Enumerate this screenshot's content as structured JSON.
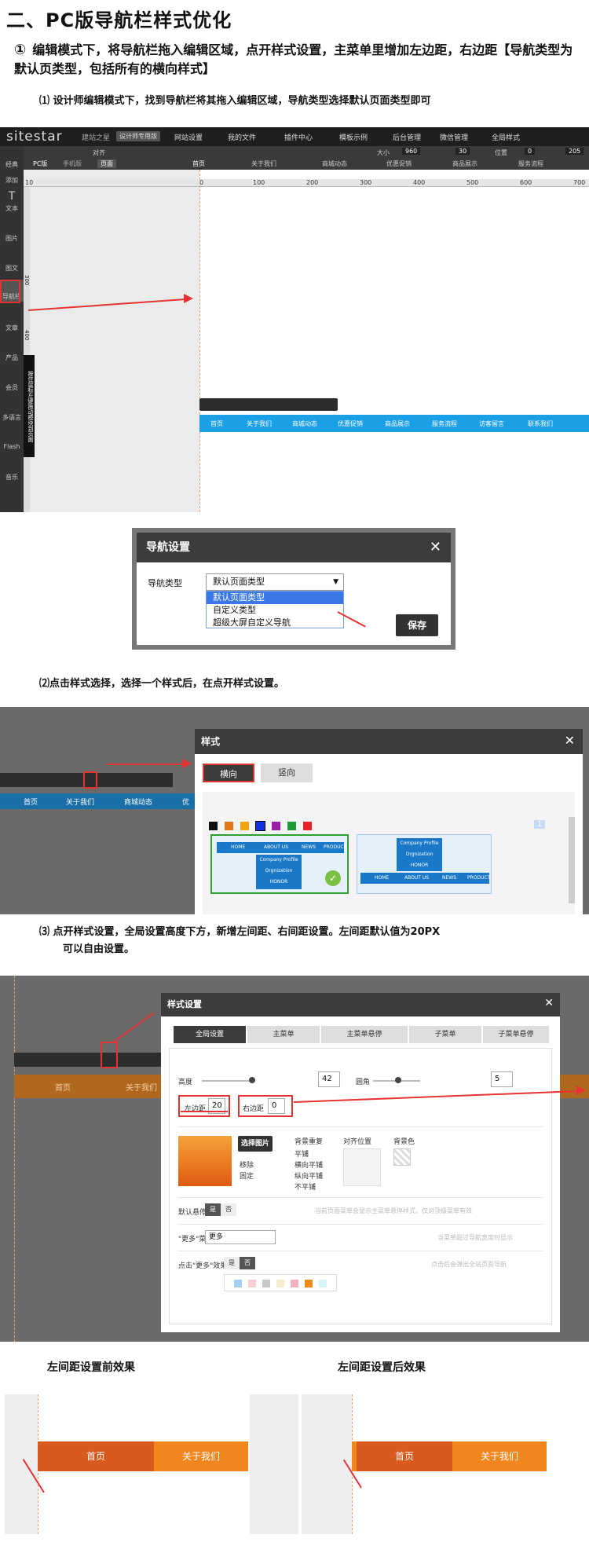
{
  "heading": "二、PC版导航栏样式优化",
  "step1": {
    "num": "①",
    "text": "编辑模式下，将导航栏拖入编辑区域，点开样式设置，主菜单里增加左边距，右边距【导航类型为默认页类型，包括所有的横向样式】"
  },
  "sub1": "⑴  设计师编辑模式下，找到导航栏将其拖入编辑区域，导航类型选择默认页面类型即可",
  "sub2": "⑵点击样式选择，选择一个样式后，在点开样式设置。",
  "sub3_line1": "⑶  点开样式设置，全局设置高度下方，新增左间距、右间距设置。左间距默认值为20PX",
  "sub3_line2": "可以自由设置。",
  "editor": {
    "logo": "sitestar",
    "logo_sub": "建站之星",
    "badge": "设计师专用版",
    "top_menu": [
      "网站设置",
      "我的文件",
      "插件中心",
      "模板示例",
      "后台管理",
      "微信管理",
      "全局样式"
    ],
    "toolbar": {
      "pc": "PC版",
      "mobile": "手机版",
      "align": "对齐",
      "size": "大小",
      "w": "960",
      "px": "px",
      "h": "30",
      "pos": "位置",
      "x": "0",
      "y": "205",
      "page_tab": "页面",
      "page_name": "首页"
    },
    "ruler_ticks": [
      "0",
      "100",
      "200",
      "300",
      "400",
      "500",
      "600",
      "700"
    ],
    "ruler_left": "10",
    "sidebar": [
      "经典",
      "添加",
      "文本",
      "图片",
      "图文",
      "导航栏",
      "文章",
      "产品",
      "会员",
      "多语言",
      "Flash",
      "音乐"
    ],
    "vruler_labels": [
      "300",
      "400",
      "500",
      "600"
    ],
    "page_tabs": [
      "关于我们",
      "商城动态",
      "优惠促销",
      "商品展示",
      "服务流程"
    ],
    "drag_tip": "按住鼠标左键拖动模块到页面",
    "nav_items": [
      "首页",
      "关于我们",
      "商城动态",
      "优惠促销",
      "商品展示",
      "服务流程",
      "访客留言",
      "联系我们"
    ]
  },
  "nav_dialog": {
    "title": "导航设置",
    "label": "导航类型",
    "selected": "默认页面类型",
    "options": [
      "默认页面类型",
      "自定义类型",
      "超级大屏自定义导航"
    ],
    "save": "保存"
  },
  "style_dialog": {
    "title": "样式",
    "tab_h": "横向",
    "tab_v": "竖向",
    "page_num": "1",
    "colors": [
      "#111111",
      "#e0761a",
      "#f2a40c",
      "#1530e0",
      "#9a1fa8",
      "#1c9d38",
      "#e8202a"
    ],
    "preview_nav": [
      "HOME",
      "ABOUT US",
      "NEWS",
      "PRODUCT"
    ],
    "preview_sub": [
      "Company Profile",
      "Orgnization",
      "HONOR"
    ],
    "bg_nav": [
      "首页",
      "关于我们",
      "商城动态",
      "优"
    ]
  },
  "style_settings": {
    "title": "样式设置",
    "tabs": [
      "全局设置",
      "主菜单",
      "主菜单悬停",
      "子菜单",
      "子菜单悬停"
    ],
    "height_label": "高度",
    "height_val": "42",
    "radius_label": "圆角",
    "radius_val": "5",
    "left_label": "左边距",
    "left_val": "20",
    "right_label": "右边距",
    "right_val": "0",
    "choose_image": "选择图片",
    "img_opts": [
      "移除",
      "固定"
    ],
    "repeat_label": "背景重复",
    "repeat_opts": [
      "平铺",
      "横向平铺",
      "纵向平铺",
      "不平铺"
    ],
    "align_label": "对齐位置",
    "bgcolor_label": "背景色",
    "default_hover": "默认悬停",
    "yes": "是",
    "no": "否",
    "hint1": "当前页面菜单会显示主菜单悬停样式，仅对顶级菜单有效",
    "more_label": "\"更多\"菜单",
    "more_val": "更多",
    "hint2": "当菜单超过导航宽度时显示",
    "more_effect": "点击\"更多\"效果",
    "hint3": "点击后会弹出全站页面导航",
    "palette": [
      "#a8cff0",
      "#f6d0d0",
      "#c8c8c8",
      "#f6eccc",
      "#f4b3c0",
      "#f08a18",
      "#d8f4f8"
    ],
    "bg_nav": [
      "首页",
      "关于我们"
    ]
  },
  "compare": {
    "before": "左间距设置前效果",
    "after": "左间距设置后效果",
    "nav": [
      "首页",
      "关于我们"
    ]
  }
}
